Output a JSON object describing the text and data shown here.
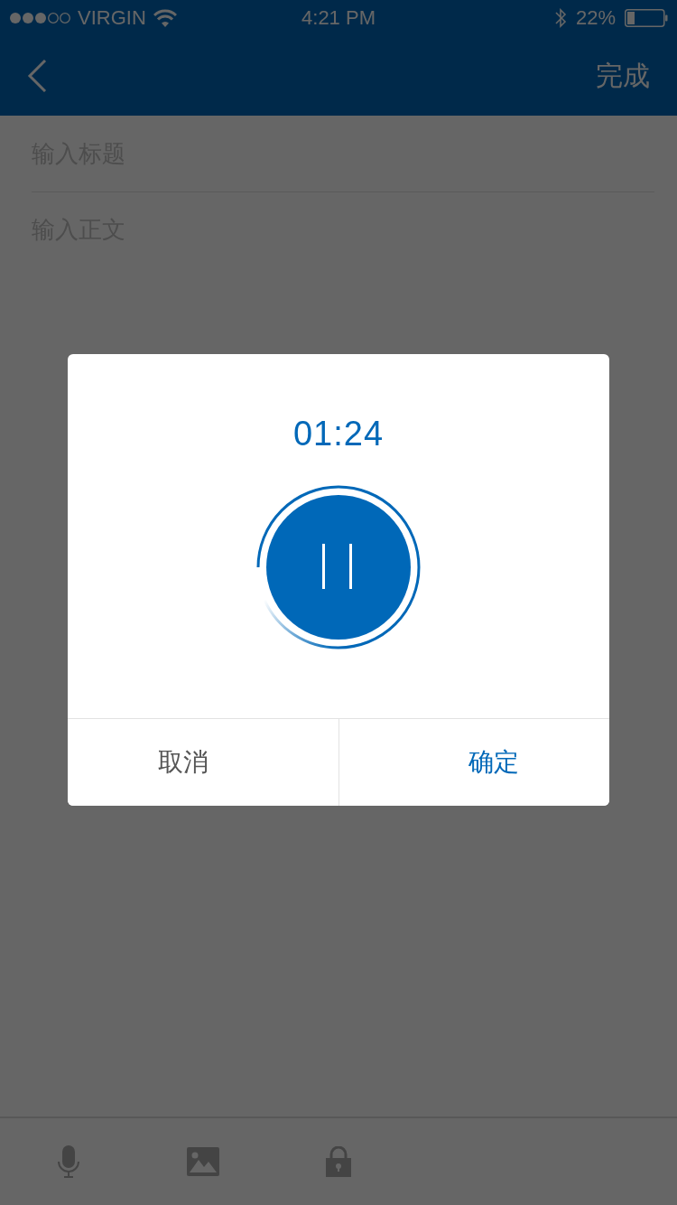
{
  "status_bar": {
    "carrier": "VIRGIN",
    "time": "4:21 PM",
    "battery": "22%"
  },
  "nav": {
    "done": "完成"
  },
  "editor": {
    "title": {
      "placeholder": "输入标题"
    },
    "body": {
      "placeholder": "输入正文"
    }
  },
  "dialog": {
    "timer": "01:24",
    "buttons": [
      {
        "label": "取消",
        "kind": "cancel"
      },
      {
        "label": "确定",
        "kind": "confirm"
      }
    ]
  }
}
